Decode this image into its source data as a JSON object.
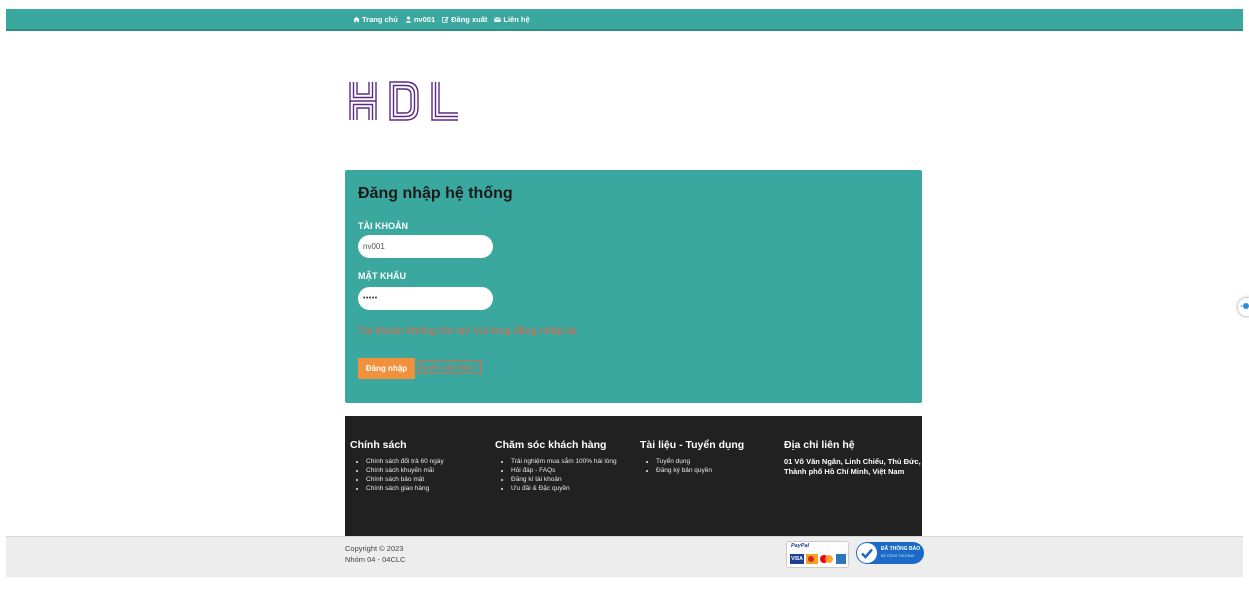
{
  "nav": {
    "home": "Trang chủ",
    "user": "nv001",
    "logout": "Đăng xuất",
    "contact": "Liên hệ"
  },
  "logo": {
    "text": "HDL",
    "color": "#5b2a86"
  },
  "login": {
    "title": "Đăng nhập hệ thống",
    "username_label": "TÀI KHOẢN",
    "username_value": "nv001",
    "password_label": "MẬT KHẨU",
    "password_value": "•••••",
    "error": "Tài khoản không tồn tại! Vui lòng đăng nhập lại",
    "submit_label": "Đăng nhập",
    "forgot_label": "Quên mật khẩu ?"
  },
  "footer": {
    "columns": [
      {
        "title": "Chính sách",
        "items": [
          "Chính sách đổi trả 60 ngày",
          "Chính sách khuyến mãi",
          "Chính sách bảo mật",
          "Chính sách giao hàng"
        ]
      },
      {
        "title": "Chăm sóc khách hàng",
        "items": [
          "Trải nghiệm mua sắm 100% hài lòng",
          "Hỏi đáp - FAQs",
          "Đăng kí tài khoản",
          "Ưu đãi & Đặc quyền"
        ]
      },
      {
        "title": "Tài liệu - Tuyển dụng",
        "items": [
          "Tuyển dụng",
          "Đăng ký bản quyền"
        ]
      },
      {
        "title": "Địa chỉ liên hệ",
        "address": "01 Võ Văn Ngân, Linh Chiểu, Thủ Đức, Thành phố Hồ Chí Minh, Việt Nam"
      }
    ]
  },
  "bottom": {
    "copyright": "Copyright © 2023",
    "group": "Nhóm 04 - 04CLC",
    "paypal": "PayPal",
    "visa": "VISA",
    "registered": "ĐÃ THÔNG BÁO",
    "registered_sub": "BỘ CÔNG THƯƠNG"
  },
  "colors": {
    "teal": "#3aa89e",
    "orange": "#f1913c",
    "error": "#e2664a",
    "footer_bg": "#212121"
  }
}
